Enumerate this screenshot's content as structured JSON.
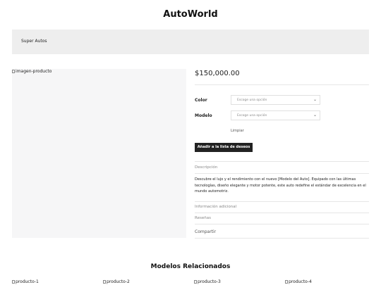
{
  "site": {
    "title": "AutoWorld"
  },
  "banner": {
    "label": "Super Autos"
  },
  "product": {
    "image_alt": "imagen-producto",
    "price": "$150,000.00",
    "options": [
      {
        "label": "Color",
        "placeholder": "Escoge una opción"
      },
      {
        "label": "Modelo",
        "placeholder": "Escoge una opción"
      }
    ],
    "clear_label": "Limpiar",
    "wishlist_label": "Añadir a la lista de deseos",
    "tabs": {
      "description": "Descripción",
      "additional_info": "Información adicional",
      "reviews": "Reseñas"
    },
    "description_text": "Descubre el lujo y el rendimiento con el nuevo [Modelo del Auto]. Equipado con las últimas tecnologías, diseño elegante y motor potente, este auto redefine el estándar de excelencia en el mundo automotriz.",
    "share_label": "Compartir"
  },
  "related": {
    "title": "Modelos Relacionados",
    "items": [
      "producto-1",
      "producto-2",
      "producto-3",
      "producto-4"
    ]
  }
}
